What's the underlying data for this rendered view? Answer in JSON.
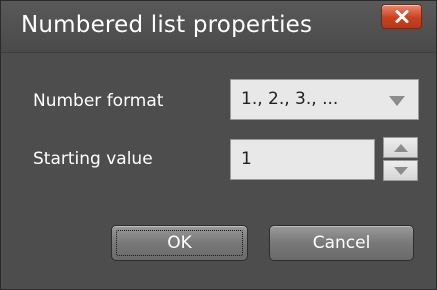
{
  "window": {
    "title": "Numbered list properties",
    "close_icon": "close-icon"
  },
  "form": {
    "number_format": {
      "label": "Number format",
      "value": "1., 2., 3., ...",
      "icon": "chevron-down-icon"
    },
    "starting_value": {
      "label": "Starting value",
      "value": "1",
      "up_icon": "spin-up-icon",
      "down_icon": "spin-down-icon"
    }
  },
  "buttons": {
    "ok_label": "OK",
    "cancel_label": "Cancel"
  },
  "colors": {
    "dialog_bg": "#4d4d4d",
    "close_accent": "#c9421f",
    "field_bg": "#e8e8e8",
    "text_light": "#ffffff"
  }
}
